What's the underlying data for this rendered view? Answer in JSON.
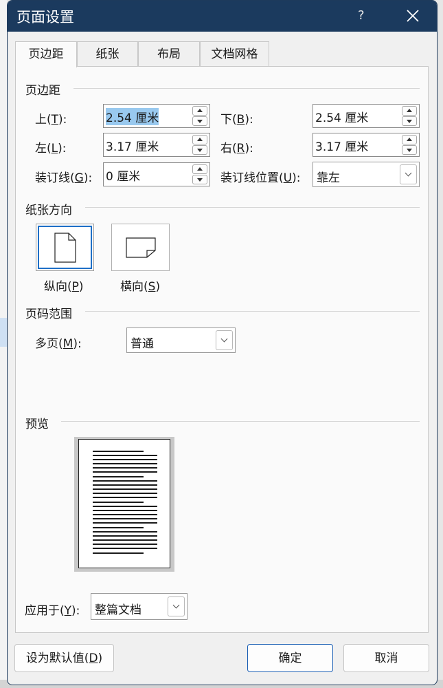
{
  "dialog": {
    "title": "页面设置",
    "help": "?"
  },
  "tabs": [
    {
      "label": "页边距"
    },
    {
      "label": "纸张"
    },
    {
      "label": "布局"
    },
    {
      "label": "文档网格"
    }
  ],
  "margins": {
    "section_title": "页边距",
    "top": {
      "label": "上(",
      "key": "T",
      "tail": "):",
      "value": "2.54 厘米"
    },
    "bottom": {
      "label": "下(",
      "key": "B",
      "tail": "):",
      "value": "2.54 厘米"
    },
    "left": {
      "label": "左(",
      "key": "L",
      "tail": "):",
      "value": "3.17 厘米"
    },
    "right": {
      "label": "右(",
      "key": "R",
      "tail": "):",
      "value": "3.17 厘米"
    },
    "gutter": {
      "label": "装订线(",
      "key": "G",
      "tail": "):",
      "value": "0 厘米"
    },
    "gutter_pos": {
      "label": "装订线位置(",
      "key": "U",
      "tail": "):",
      "value": "靠左"
    }
  },
  "orientation": {
    "section_title": "纸张方向",
    "portrait": {
      "label": "纵向(",
      "key": "P",
      "tail": ")"
    },
    "landscape": {
      "label": "横向(",
      "key": "S",
      "tail": ")"
    }
  },
  "pages": {
    "section_title": "页码范围",
    "multiple": {
      "label": "多页(",
      "key": "M",
      "tail": "):",
      "value": "普通"
    }
  },
  "preview": {
    "section_title": "预览"
  },
  "apply": {
    "label": "应用于(",
    "key": "Y",
    "tail": "):",
    "value": "整篇文档"
  },
  "buttons": {
    "default": {
      "label": "设为默认值(",
      "key": "D",
      "tail": ")"
    },
    "ok": "确定",
    "cancel": "取消"
  }
}
